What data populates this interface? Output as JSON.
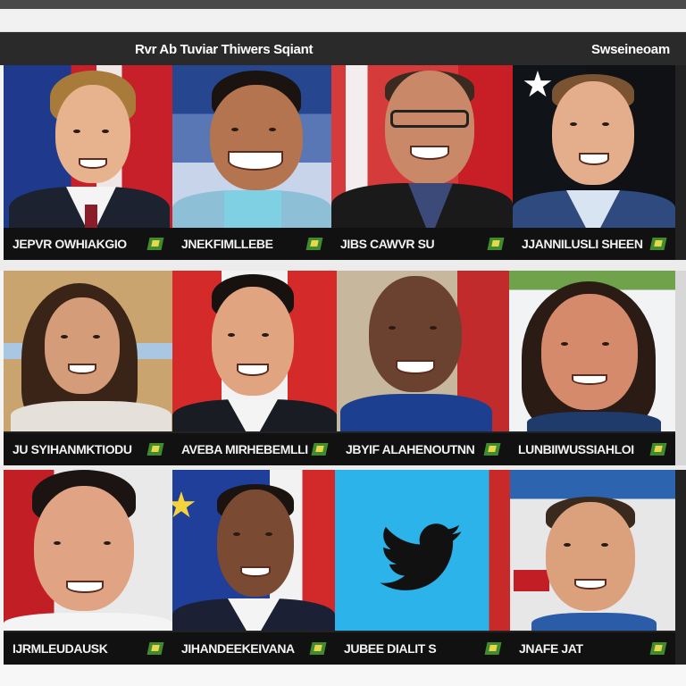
{
  "header": {
    "title": "Rvr Ab Tuviar Thiwers Sqiant",
    "right_label": "Swseineoam"
  },
  "cards": [
    {
      "caption": "JEPVR OWHIAKGIO",
      "badge_icon": "flag-badge-icon"
    },
    {
      "caption": "JNEKFIMLLEBE",
      "badge_icon": "flag-badge-icon"
    },
    {
      "caption": "JIBS CAWVR SU",
      "badge_icon": "flag-badge-icon"
    },
    {
      "caption": "JJANNILUSLI SHEEN",
      "badge_icon": "flag-badge-icon"
    },
    {
      "caption": "JU SYIHANMKTIODU",
      "badge_icon": "flag-badge-icon"
    },
    {
      "caption": "AVEBA MIRHEBEMLLI",
      "badge_icon": "flag-badge-icon"
    },
    {
      "caption": "JBYIF ALAHENOUTNN",
      "badge_icon": "flag-badge-icon"
    },
    {
      "caption": "LUNBIIWUSSIAHLOI",
      "badge_icon": "flag-badge-icon"
    },
    {
      "caption": "IJRMLEUDAUSK",
      "badge_icon": "flag-badge-icon"
    },
    {
      "caption": "JIHANDEEKEIVANA",
      "badge_icon": "flag-badge-icon"
    },
    {
      "caption": "JUBEE DIALIT S",
      "badge_icon": "flag-badge-icon"
    },
    {
      "caption": "JNAFE JAT",
      "badge_icon": "flag-badge-icon"
    }
  ],
  "icons": {
    "bird": "twitter-bird-icon",
    "star": "flag-star-icon"
  },
  "colors": {
    "header_bg": "#2a2a2a",
    "caption_bg": "#111111",
    "twitter_bg": "#1da1f2",
    "flag_red": "#c8202a",
    "flag_blue": "#1f3a8c"
  }
}
